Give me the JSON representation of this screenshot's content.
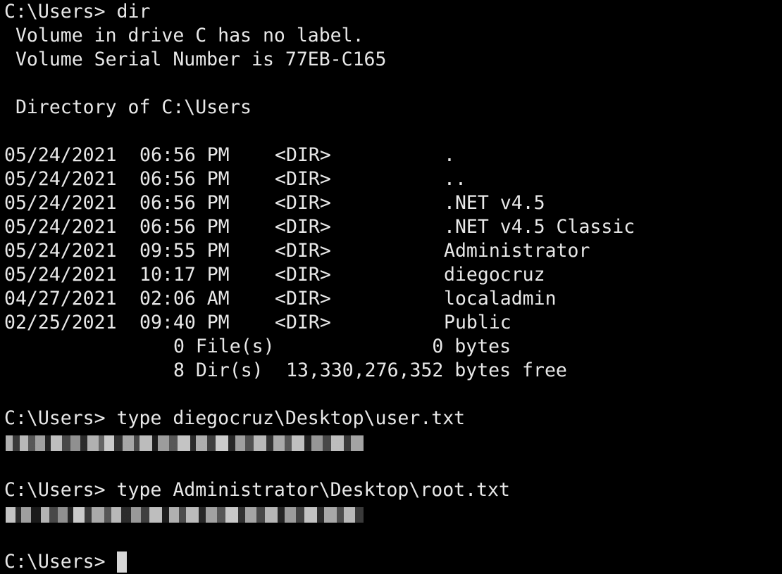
{
  "prompt": "C:\\Users> ",
  "commands": {
    "first": "dir",
    "second": "type diegocruz\\Desktop\\user.txt",
    "third": "type Administrator\\Desktop\\root.txt"
  },
  "volume": {
    "label_line": " Volume in drive C has no label.",
    "serial_line": " Volume Serial Number is 77EB-C165",
    "directory_line": " Directory of C:\\Users"
  },
  "entries": [
    {
      "date": "05/24/2021",
      "time": "06:56 PM",
      "type": "<DIR>",
      "name": "."
    },
    {
      "date": "05/24/2021",
      "time": "06:56 PM",
      "type": "<DIR>",
      "name": ".."
    },
    {
      "date": "05/24/2021",
      "time": "06:56 PM",
      "type": "<DIR>",
      "name": ".NET v4.5"
    },
    {
      "date": "05/24/2021",
      "time": "06:56 PM",
      "type": "<DIR>",
      "name": ".NET v4.5 Classic"
    },
    {
      "date": "05/24/2021",
      "time": "09:55 PM",
      "type": "<DIR>",
      "name": "Administrator"
    },
    {
      "date": "05/24/2021",
      "time": "10:17 PM",
      "type": "<DIR>",
      "name": "diegocruz"
    },
    {
      "date": "04/27/2021",
      "time": "02:06 AM",
      "type": "<DIR>",
      "name": "localadmin"
    },
    {
      "date": "02/25/2021",
      "time": "09:40 PM",
      "type": "<DIR>",
      "name": "Public"
    }
  ],
  "summary": {
    "files_count": "0 File(s)",
    "files_size": "             0 bytes",
    "dirs_count": "8 Dir(s)",
    "dirs_free": "13,330,276,352 bytes free"
  },
  "colors": {
    "background": "#000000",
    "foreground": "#e8e8e8",
    "cursor": "#d6d6d6"
  }
}
